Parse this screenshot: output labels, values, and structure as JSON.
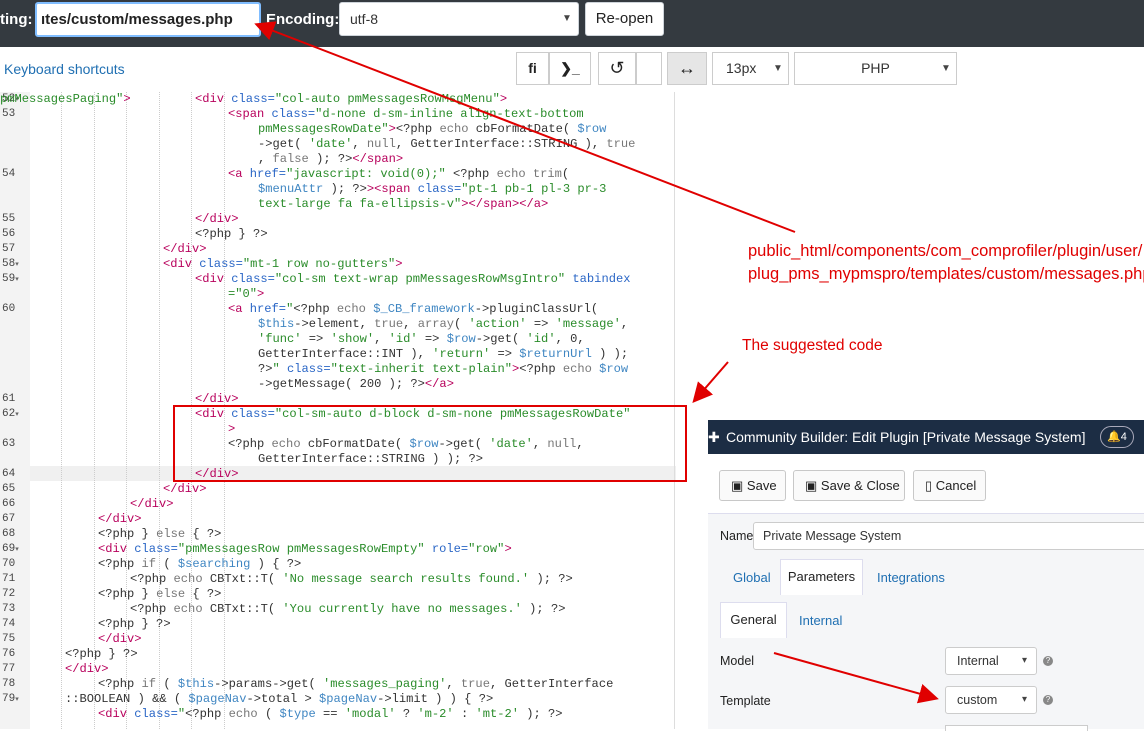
{
  "top": {
    "label_left": "ting:",
    "file_path": "ıtes/custom/messages.php",
    "encoding_label": "Encoding:",
    "encoding_value": "utf-8",
    "reopen_label": "Re-open"
  },
  "toolbar": {
    "shortcuts_label": "Keyboard shortcuts",
    "search_glyph": "ﬁ",
    "terminal_glyph": "❯_",
    "undo_glyph": "↺",
    "wrap_glyph": "↔",
    "font_size": "13px",
    "language": "PHP"
  },
  "editor": {
    "line_numbers": [
      {
        "n": "52",
        "f": "▾"
      },
      {
        "n": "53",
        "f": ""
      },
      {
        "n": "54",
        "f": ""
      },
      {
        "n": "55",
        "f": ""
      },
      {
        "n": "56",
        "f": ""
      },
      {
        "n": "57",
        "f": ""
      },
      {
        "n": "58",
        "f": "▾"
      },
      {
        "n": "59",
        "f": "▾"
      },
      {
        "n": "60",
        "f": ""
      },
      {
        "n": "61",
        "f": ""
      },
      {
        "n": "62",
        "f": "▾"
      },
      {
        "n": "63",
        "f": ""
      },
      {
        "n": "64",
        "f": ""
      },
      {
        "n": "65",
        "f": ""
      },
      {
        "n": "66",
        "f": ""
      },
      {
        "n": "67",
        "f": ""
      },
      {
        "n": "68",
        "f": ""
      },
      {
        "n": "69",
        "f": "▾"
      },
      {
        "n": "70",
        "f": ""
      },
      {
        "n": "71",
        "f": ""
      },
      {
        "n": "72",
        "f": ""
      },
      {
        "n": "73",
        "f": ""
      },
      {
        "n": "74",
        "f": ""
      },
      {
        "n": "75",
        "f": ""
      },
      {
        "n": "76",
        "f": ""
      },
      {
        "n": "77",
        "f": ""
      },
      {
        "n": "78",
        "f": ""
      },
      {
        "n": "79",
        "f": "▾"
      }
    ],
    "lines": [
      [
        [
          {
            "c": "t",
            "x": "<div "
          },
          {
            "c": "a",
            "x": "class="
          },
          {
            "c": "s",
            "x": "\"col-auto pmMessagesRowMsgMenu\""
          },
          {
            "c": "t",
            "x": ">"
          }
        ]
      ],
      [
        [
          {
            "c": "t",
            "x": "<span "
          },
          {
            "c": "a",
            "x": "class="
          },
          {
            "c": "s",
            "x": "\"d-none d-sm-inline align-text-bottom"
          }
        ]
      ],
      [
        [
          {
            "c": "s",
            "x": "pmMessagesRowDate\""
          },
          {
            "c": "t",
            "x": ">"
          },
          {
            "c": "n",
            "x": "<?php "
          },
          {
            "c": "k",
            "x": "echo "
          },
          {
            "c": "n",
            "x": "cbFormatDate( "
          },
          {
            "c": "v",
            "x": "$row"
          }
        ]
      ],
      [
        [
          {
            "c": "n",
            "x": "->get( "
          },
          {
            "c": "s",
            "x": "'date'"
          },
          {
            "c": "n",
            "x": ", "
          },
          {
            "c": "k",
            "x": "null"
          },
          {
            "c": "n",
            "x": ", GetterInterface::STRING ), "
          },
          {
            "c": "k",
            "x": "true"
          }
        ]
      ],
      [
        [
          {
            "c": "n",
            "x": ", "
          },
          {
            "c": "k",
            "x": "false"
          },
          {
            "c": "n",
            "x": " ); ?>"
          },
          {
            "c": "t",
            "x": "</span>"
          }
        ]
      ],
      [
        [
          {
            "c": "t",
            "x": "<a "
          },
          {
            "c": "a",
            "x": "href="
          },
          {
            "c": "s",
            "x": "\"javascript: void(0);\""
          },
          {
            "c": "n",
            "x": " <?php "
          },
          {
            "c": "k",
            "x": "echo trim"
          },
          {
            "c": "n",
            "x": "("
          }
        ]
      ],
      [
        [
          {
            "c": "v",
            "x": "$menuAttr"
          },
          {
            "c": "n",
            "x": " ); ?>"
          },
          {
            "c": "t",
            "x": "><span "
          },
          {
            "c": "a",
            "x": "class="
          },
          {
            "c": "s",
            "x": "\"pt-1 pb-1 pl-3 pr-3"
          }
        ]
      ],
      [
        [
          {
            "c": "s",
            "x": "text-large fa fa-ellipsis-v\""
          },
          {
            "c": "t",
            "x": "></span></a>"
          }
        ]
      ],
      [
        [
          {
            "c": "t",
            "x": "</div>"
          }
        ]
      ],
      [
        [
          {
            "c": "n",
            "x": "<?php } ?>"
          }
        ]
      ],
      [
        [
          {
            "c": "t",
            "x": "</div>"
          }
        ]
      ],
      [
        [
          {
            "c": "t",
            "x": "<div "
          },
          {
            "c": "a",
            "x": "class="
          },
          {
            "c": "s",
            "x": "\"mt-1 row no-gutters\""
          },
          {
            "c": "t",
            "x": ">"
          }
        ]
      ],
      [
        [
          {
            "c": "t",
            "x": "<div "
          },
          {
            "c": "a",
            "x": "class="
          },
          {
            "c": "s",
            "x": "\"col-sm text-wrap pmMessagesRowMsgIntro\""
          },
          {
            "c": "a",
            "x": " tabindex"
          }
        ]
      ],
      [
        [
          {
            "c": "s",
            "x": "=\"0\""
          },
          {
            "c": "t",
            "x": ">"
          }
        ]
      ],
      [
        [
          {
            "c": "t",
            "x": "<a "
          },
          {
            "c": "a",
            "x": "href="
          },
          {
            "c": "s",
            "x": "\""
          },
          {
            "c": "n",
            "x": "<?php "
          },
          {
            "c": "k",
            "x": "echo "
          },
          {
            "c": "v",
            "x": "$_CB_framework"
          },
          {
            "c": "n",
            "x": "->pluginClassUrl("
          }
        ]
      ],
      [
        [
          {
            "c": "v",
            "x": "$this"
          },
          {
            "c": "n",
            "x": "->element, "
          },
          {
            "c": "k",
            "x": "true"
          },
          {
            "c": "n",
            "x": ", "
          },
          {
            "c": "k",
            "x": "array"
          },
          {
            "c": "n",
            "x": "( "
          },
          {
            "c": "s",
            "x": "'action'"
          },
          {
            "c": "n",
            "x": " => "
          },
          {
            "c": "s",
            "x": "'message'"
          },
          {
            "c": "n",
            "x": ","
          }
        ]
      ],
      [
        [
          {
            "c": "s",
            "x": "'func'"
          },
          {
            "c": "n",
            "x": " => "
          },
          {
            "c": "s",
            "x": "'show'"
          },
          {
            "c": "n",
            "x": ", "
          },
          {
            "c": "s",
            "x": "'id'"
          },
          {
            "c": "n",
            "x": " => "
          },
          {
            "c": "v",
            "x": "$row"
          },
          {
            "c": "n",
            "x": "->get( "
          },
          {
            "c": "s",
            "x": "'id'"
          },
          {
            "c": "n",
            "x": ", 0,"
          }
        ]
      ],
      [
        [
          {
            "c": "n",
            "x": "GetterInterface::INT ), "
          },
          {
            "c": "s",
            "x": "'return'"
          },
          {
            "c": "n",
            "x": " => "
          },
          {
            "c": "v",
            "x": "$returnUrl"
          },
          {
            "c": "n",
            "x": " ) );"
          }
        ]
      ],
      [
        [
          {
            "c": "n",
            "x": "?>"
          },
          {
            "c": "s",
            "x": "\""
          },
          {
            "c": "a",
            "x": " class="
          },
          {
            "c": "s",
            "x": "\"text-inherit text-plain\""
          },
          {
            "c": "t",
            "x": ">"
          },
          {
            "c": "n",
            "x": "<?php "
          },
          {
            "c": "k",
            "x": "echo "
          },
          {
            "c": "v",
            "x": "$row"
          }
        ]
      ],
      [
        [
          {
            "c": "n",
            "x": "->getMessage( 200 ); ?>"
          },
          {
            "c": "t",
            "x": "</a>"
          }
        ]
      ],
      [
        [
          {
            "c": "t",
            "x": "</div>"
          }
        ]
      ],
      [
        [
          {
            "c": "t",
            "x": "<div "
          },
          {
            "c": "a",
            "x": "class="
          },
          {
            "c": "s",
            "x": "\"col-sm-auto d-block d-sm-none pmMessagesRowDate\""
          }
        ]
      ],
      [
        [
          {
            "c": "t",
            "x": ">"
          }
        ]
      ],
      [
        [
          {
            "c": "n",
            "x": "<?php "
          },
          {
            "c": "k",
            "x": "echo "
          },
          {
            "c": "n",
            "x": "cbFormatDate( "
          },
          {
            "c": "v",
            "x": "$row"
          },
          {
            "c": "n",
            "x": "->get( "
          },
          {
            "c": "s",
            "x": "'date'"
          },
          {
            "c": "n",
            "x": ", "
          },
          {
            "c": "k",
            "x": "null"
          },
          {
            "c": "n",
            "x": ","
          }
        ]
      ],
      [
        [
          {
            "c": "n",
            "x": "GetterInterface::STRING ) ); ?>"
          }
        ]
      ],
      [
        [
          {
            "c": "t",
            "x": "</div>"
          }
        ]
      ],
      [
        [
          {
            "c": "t",
            "x": "</div>"
          }
        ]
      ],
      [
        [
          {
            "c": "t",
            "x": "</div>"
          }
        ]
      ],
      [
        [
          {
            "c": "t",
            "x": "</div>"
          }
        ]
      ],
      [
        [
          {
            "c": "n",
            "x": "<?php } "
          },
          {
            "c": "k",
            "x": "else"
          },
          {
            "c": "n",
            "x": " { ?>"
          }
        ]
      ],
      [
        [
          {
            "c": "t",
            "x": "<div "
          },
          {
            "c": "a",
            "x": "class="
          },
          {
            "c": "s",
            "x": "\"pmMessagesRow pmMessagesRowEmpty\""
          },
          {
            "c": "a",
            "x": " role="
          },
          {
            "c": "s",
            "x": "\"row\""
          },
          {
            "c": "t",
            "x": ">"
          }
        ]
      ],
      [
        [
          {
            "c": "n",
            "x": "<?php "
          },
          {
            "c": "k",
            "x": "if"
          },
          {
            "c": "n",
            "x": " ( "
          },
          {
            "c": "v",
            "x": "$searching"
          },
          {
            "c": "n",
            "x": " ) { ?>"
          }
        ]
      ],
      [
        [
          {
            "c": "n",
            "x": "<?php "
          },
          {
            "c": "k",
            "x": "echo "
          },
          {
            "c": "n",
            "x": "CBTxt::T( "
          },
          {
            "c": "s",
            "x": "'No message search results found.'"
          },
          {
            "c": "n",
            "x": " ); ?>"
          }
        ]
      ],
      [
        [
          {
            "c": "n",
            "x": "<?php } "
          },
          {
            "c": "k",
            "x": "else"
          },
          {
            "c": "n",
            "x": " { ?>"
          }
        ]
      ],
      [
        [
          {
            "c": "n",
            "x": "<?php "
          },
          {
            "c": "k",
            "x": "echo "
          },
          {
            "c": "n",
            "x": "CBTxt::T( "
          },
          {
            "c": "s",
            "x": "'You currently have no messages.'"
          },
          {
            "c": "n",
            "x": " ); ?>"
          }
        ]
      ],
      [
        [
          {
            "c": "n",
            "x": "<?php } ?>"
          }
        ]
      ],
      [
        [
          {
            "c": "t",
            "x": "</div>"
          }
        ]
      ],
      [
        [
          {
            "c": "n",
            "x": "<?php } ?>"
          }
        ]
      ],
      [
        [
          {
            "c": "t",
            "x": "</div>"
          }
        ]
      ],
      [
        [
          {
            "c": "n",
            "x": "<?php "
          },
          {
            "c": "k",
            "x": "if"
          },
          {
            "c": "n",
            "x": " ( "
          },
          {
            "c": "v",
            "x": "$this"
          },
          {
            "c": "n",
            "x": "->params->get( "
          },
          {
            "c": "s",
            "x": "'messages_paging'"
          },
          {
            "c": "n",
            "x": ", "
          },
          {
            "c": "k",
            "x": "true"
          },
          {
            "c": "n",
            "x": ", GetterInterface"
          }
        ]
      ],
      [
        [
          {
            "c": "n",
            "x": "::BOOLEAN ) && ( "
          },
          {
            "c": "v",
            "x": "$pageNav"
          },
          {
            "c": "n",
            "x": "->total > "
          },
          {
            "c": "v",
            "x": "$pageNav"
          },
          {
            "c": "n",
            "x": "->limit ) ) { ?>"
          }
        ]
      ],
      [
        [
          {
            "c": "t",
            "x": "<div "
          },
          {
            "c": "a",
            "x": "class="
          },
          {
            "c": "s",
            "x": "\""
          },
          {
            "c": "n",
            "x": "<?php "
          },
          {
            "c": "k",
            "x": "echo"
          },
          {
            "c": "n",
            "x": " ( "
          },
          {
            "c": "v",
            "x": "$type"
          },
          {
            "c": "n",
            "x": " == "
          },
          {
            "c": "s",
            "x": "'modal'"
          },
          {
            "c": "n",
            "x": " ? "
          },
          {
            "c": "s",
            "x": "'m-2'"
          },
          {
            "c": "n",
            "x": " : "
          },
          {
            "c": "s",
            "x": "'mt-2'"
          },
          {
            "c": "n",
            "x": " ); ?>"
          }
        ]
      ],
      [
        [
          {
            "c": "s",
            "x": "pmMessagesPaging\""
          },
          {
            "c": "t",
            "x": ">"
          }
        ]
      ]
    ]
  },
  "annotations": {
    "path_line1": "public_html/components/com_comprofiler/plugin/user/",
    "path_line2": "plug_pms_mypmspro/templates/custom/messages.php",
    "suggested": "The suggested code"
  },
  "panel": {
    "title": "Community Builder: Edit Plugin [Private Message System]",
    "notifications": "4",
    "save": "Save",
    "save_close": "Save & Close",
    "cancel": "Cancel",
    "name_label": "Name",
    "name_value": "Private Message System",
    "tabs": [
      "Global",
      "Parameters",
      "Integrations"
    ],
    "subtabs": [
      "General",
      "Internal"
    ],
    "model_label": "Model",
    "model_value": "Internal",
    "template_label": "Template",
    "template_value": "custom"
  },
  "colors": {
    "accent": "#e00000",
    "topbar": "#343a40",
    "panel_header": "#1c2d44"
  }
}
